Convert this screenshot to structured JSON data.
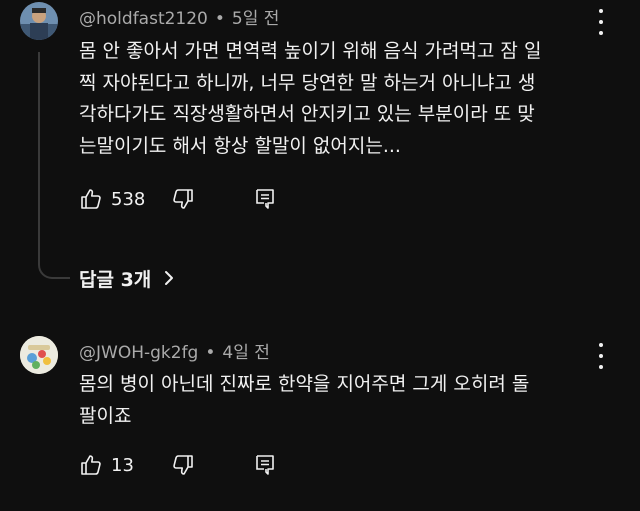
{
  "comments": [
    {
      "author": "@holdfast2120",
      "separator": "•",
      "time": "5일 전",
      "lines": [
        "몸 안 좋아서 가면 면역력 높이기 위해 음식 가려먹고 잠 일",
        "찍 자야된다고 하니까, 너무 당연한 말 하는거 아니냐고 생",
        "각하다가도 직장생활하면서 안지키고 있는 부분이라 또 맞",
        "는말이기도 해서 항상 할말이 없어지는..."
      ],
      "likes": "538",
      "replies_label": "답글 3개"
    },
    {
      "author": "@JWOH-gk2fg",
      "separator": "•",
      "time": "4일 전",
      "lines": [
        "몸의 병이 아닌데 진짜로 한약을 지어주면 그게 오히려 돌",
        "팔이죠"
      ],
      "likes": "13"
    }
  ],
  "colors": {
    "background": "#0f0f0f",
    "text": "#f1f1f1",
    "meta": "#aaaaaa",
    "thread_line": "#3a3a3a"
  },
  "icons": [
    "thumbs-up-icon",
    "thumbs-down-icon",
    "reply-icon",
    "more-vert-icon",
    "chevron-right-icon"
  ]
}
